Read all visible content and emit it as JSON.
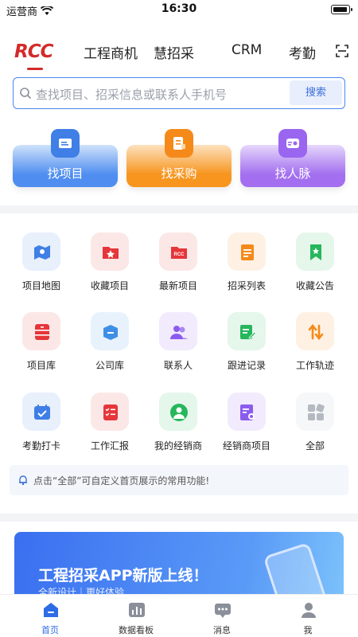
{
  "status": {
    "carrier": "运营商",
    "time": "16:30"
  },
  "brand": {
    "logo": "RCC",
    "color": "#d42a2a"
  },
  "nav": {
    "tabs": [
      "工程商机",
      "慧招采",
      "CRM",
      "考勤"
    ]
  },
  "search": {
    "placeholder": "查找项目、招采信息或联系人手机号",
    "button": "搜索"
  },
  "quick": [
    {
      "label": "找项目",
      "icon": "project-folder-icon"
    },
    {
      "label": "找采购",
      "icon": "purchase-document-icon"
    },
    {
      "label": "找人脉",
      "icon": "contacts-card-icon"
    }
  ],
  "grid": [
    {
      "label": "项目地图",
      "icon": "map-icon",
      "color": "#3f7fe6"
    },
    {
      "label": "收藏项目",
      "icon": "favorite-folder-icon",
      "color": "#e5363a"
    },
    {
      "label": "最新项目",
      "icon": "rcc-folder-icon",
      "color": "#e5363a"
    },
    {
      "label": "招采列表",
      "icon": "document-list-icon",
      "color": "#f58a1a"
    },
    {
      "label": "收藏公告",
      "icon": "bookmark-icon",
      "color": "#26b65c"
    },
    {
      "label": "项目库",
      "icon": "cabinet-icon",
      "color": "#e5363a"
    },
    {
      "label": "公司库",
      "icon": "box-icon",
      "color": "#3f8fe6"
    },
    {
      "label": "联系人",
      "icon": "people-icon",
      "color": "#8b5cf0"
    },
    {
      "label": "跟进记录",
      "icon": "edit-note-icon",
      "color": "#26b65c"
    },
    {
      "label": "工作轨迹",
      "icon": "track-arrows-icon",
      "color": "#f58a1a"
    },
    {
      "label": "考勤打卡",
      "icon": "calendar-check-icon",
      "color": "#3f7fe6"
    },
    {
      "label": "工作汇报",
      "icon": "report-checklist-icon",
      "color": "#e5363a"
    },
    {
      "label": "我的经销商",
      "icon": "dealer-person-icon",
      "color": "#26b65c"
    },
    {
      "label": "经销商项目",
      "icon": "dealer-project-icon",
      "color": "#8b5cf0"
    },
    {
      "label": "全部",
      "icon": "all-grid-icon",
      "color": "#b5b9c2"
    }
  ],
  "tip": {
    "text": "点击“全部”可自定义首页展示的常用功能!"
  },
  "banner": {
    "title": "工程招采APP新版上线！",
    "subtitle": "全新设计｜更好体验"
  },
  "tabbar": [
    {
      "label": "首页",
      "icon": "home-icon",
      "active": true
    },
    {
      "label": "数据看板",
      "icon": "dashboard-icon",
      "active": false
    },
    {
      "label": "消息",
      "icon": "message-icon",
      "active": false
    },
    {
      "label": "我",
      "icon": "profile-icon",
      "active": false
    }
  ]
}
